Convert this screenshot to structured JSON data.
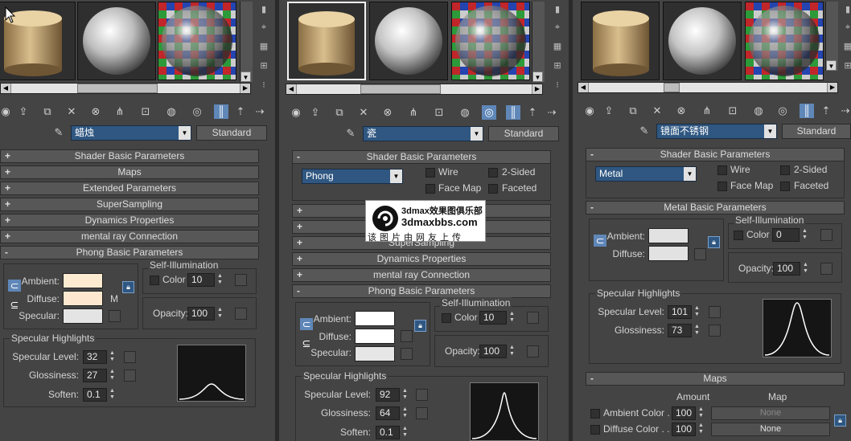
{
  "panels": [
    {
      "material_name": "蜡烛",
      "material_type": "Standard",
      "rollouts_top": [
        {
          "sign": "+",
          "label": "Shader Basic Parameters"
        },
        {
          "sign": "+",
          "label": "Maps"
        },
        {
          "sign": "+",
          "label": "Extended Parameters"
        },
        {
          "sign": "+",
          "label": "SuperSampling"
        },
        {
          "sign": "+",
          "label": "Dynamics Properties"
        },
        {
          "sign": "+",
          "label": "mental ray Connection"
        },
        {
          "sign": "-",
          "label": "Phong Basic Parameters"
        }
      ],
      "ambient_label": "Ambient:",
      "diffuse_label": "Diffuse:",
      "specular_label": "Specular:",
      "map_letter": "M",
      "self_illum_label": "Self-Illumination",
      "color_label": "Color",
      "self_illum_value": "10",
      "opacity_label": "Opacity:",
      "opacity_value": "100",
      "spec_group_label": "Specular Highlights",
      "spec_level_label": "Specular Level:",
      "spec_level_value": "32",
      "glossiness_label": "Glossiness:",
      "glossiness_value": "27",
      "soften_label": "Soften:",
      "soften_value": "0.1",
      "colors": {
        "ambient": "#fdebd1",
        "diffuse": "#fde8cf",
        "specular": "#e4e4e4"
      }
    },
    {
      "material_name": "瓷",
      "material_type": "Standard",
      "shader_rollout": {
        "sign": "-",
        "label": "Shader Basic Parameters"
      },
      "shader_value": "Phong",
      "wire_label": "Wire",
      "two_sided_label": "2-Sided",
      "face_map_label": "Face Map",
      "faceted_label": "Faceted",
      "rollouts_top": [
        {
          "sign": "+",
          "label": ""
        },
        {
          "sign": "+",
          "label": ""
        },
        {
          "sign": "+",
          "label": "SuperSampling"
        },
        {
          "sign": "+",
          "label": "Dynamics Properties"
        },
        {
          "sign": "+",
          "label": "mental ray Connection"
        },
        {
          "sign": "-",
          "label": "Phong Basic Parameters"
        }
      ],
      "ambient_label": "Ambient:",
      "diffuse_label": "Diffuse:",
      "specular_label": "Specular:",
      "self_illum_label": "Self-Illumination",
      "color_label": "Color",
      "self_illum_value": "10",
      "opacity_label": "Opacity:",
      "opacity_value": "100",
      "spec_group_label": "Specular Highlights",
      "spec_level_label": "Specular Level:",
      "spec_level_value": "92",
      "glossiness_label": "Glossiness:",
      "glossiness_value": "64",
      "soften_label": "Soften:",
      "soften_value": "0.1",
      "colors": {
        "ambient": "#ffffff",
        "diffuse": "#ffffff",
        "specular": "#e6e6e6"
      }
    },
    {
      "material_name": "镜面不锈钢",
      "material_type": "Standard",
      "shader_rollout": {
        "sign": "-",
        "label": "Shader Basic Parameters"
      },
      "shader_value": "Metal",
      "wire_label": "Wire",
      "two_sided_label": "2-Sided",
      "face_map_label": "Face Map",
      "faceted_label": "Faceted",
      "metal_rollout": {
        "sign": "-",
        "label": "Metal Basic Parameters"
      },
      "ambient_label": "Ambient:",
      "diffuse_label": "Diffuse:",
      "self_illum_label": "Self-Illumination",
      "color_label": "Color",
      "self_illum_value": "0",
      "opacity_label": "Opacity:",
      "opacity_value": "100",
      "spec_group_label": "Specular Highlights",
      "spec_level_label": "Specular Level:",
      "spec_level_value": "101",
      "glossiness_label": "Glossiness:",
      "glossiness_value": "73",
      "maps_rollout": {
        "sign": "-",
        "label": "Maps"
      },
      "maps_amount_header": "Amount",
      "maps_map_header": "Map",
      "map_rows": [
        {
          "label": "Ambient Color . . .",
          "amount": "100",
          "map": "None"
        },
        {
          "label": "Diffuse Color . . . .",
          "amount": "100",
          "map": "None"
        }
      ],
      "colors": {
        "ambient": "#e2e2e2",
        "diffuse": "#e2e2e2"
      }
    }
  ],
  "watermark": {
    "site_title": "3dmax效果图俱乐部",
    "site_url": "3dmaxbbs.com",
    "caption": "该图片由网友上传"
  }
}
